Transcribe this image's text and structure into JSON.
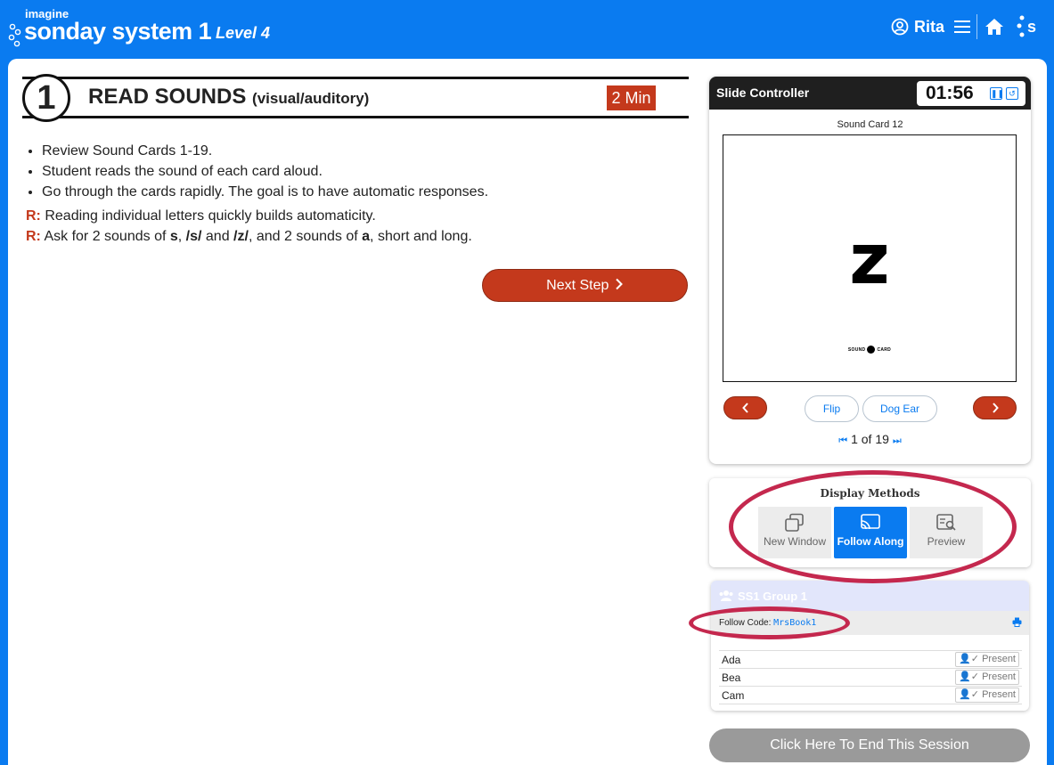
{
  "header": {
    "brand_imagine": "imagine",
    "brand_name": "sonday system 1",
    "level": "Level 4",
    "user_name": "Rita"
  },
  "step": {
    "number": "1",
    "title": "READ SOUNDS",
    "subtitle": "(visual/auditory)",
    "duration": "2 Min",
    "bullets": [
      "Review Sound Cards 1-19.",
      "Student reads the sound of each card aloud.",
      "Go through the cards rapidly. The goal is to have automatic responses."
    ],
    "r_label": "R:",
    "r1": "Reading individual letters quickly builds automaticity.",
    "r2_parts": [
      "Ask for 2 sounds of ",
      "s",
      ", ",
      "/s/",
      " and ",
      "/z/",
      ", and 2 sounds of ",
      "a",
      ", short and long."
    ],
    "next_label": "Next Step"
  },
  "slide_controller": {
    "title": "Slide Controller",
    "timer": "01:56",
    "card_label": "Sound Card 12",
    "card_letter": "z",
    "card_foot_left": "SOUND",
    "card_foot_num": "12",
    "card_foot_right": "CARD",
    "flip_label": "Flip",
    "dog_ear_label": "Dog Ear",
    "page_current": "1",
    "page_of": "of",
    "page_total": "19"
  },
  "display_methods": {
    "title": "Display Methods",
    "options": [
      {
        "label": "New Window",
        "active": false
      },
      {
        "label": "Follow Along",
        "active": true
      },
      {
        "label": "Preview",
        "active": false
      }
    ]
  },
  "group": {
    "title": "SS1 Group 1",
    "follow_code_label": "Follow Code:",
    "follow_code": "MrsBook1",
    "students": [
      {
        "name": "Ada",
        "status": "Present"
      },
      {
        "name": "Bea",
        "status": "Present"
      },
      {
        "name": "Cam",
        "status": "Present"
      }
    ]
  },
  "end_session_label": "Click Here To End This Session",
  "colors": {
    "primary_blue": "#0a7bf0",
    "accent_red": "#c4391c",
    "annotation": "#c4284e"
  }
}
